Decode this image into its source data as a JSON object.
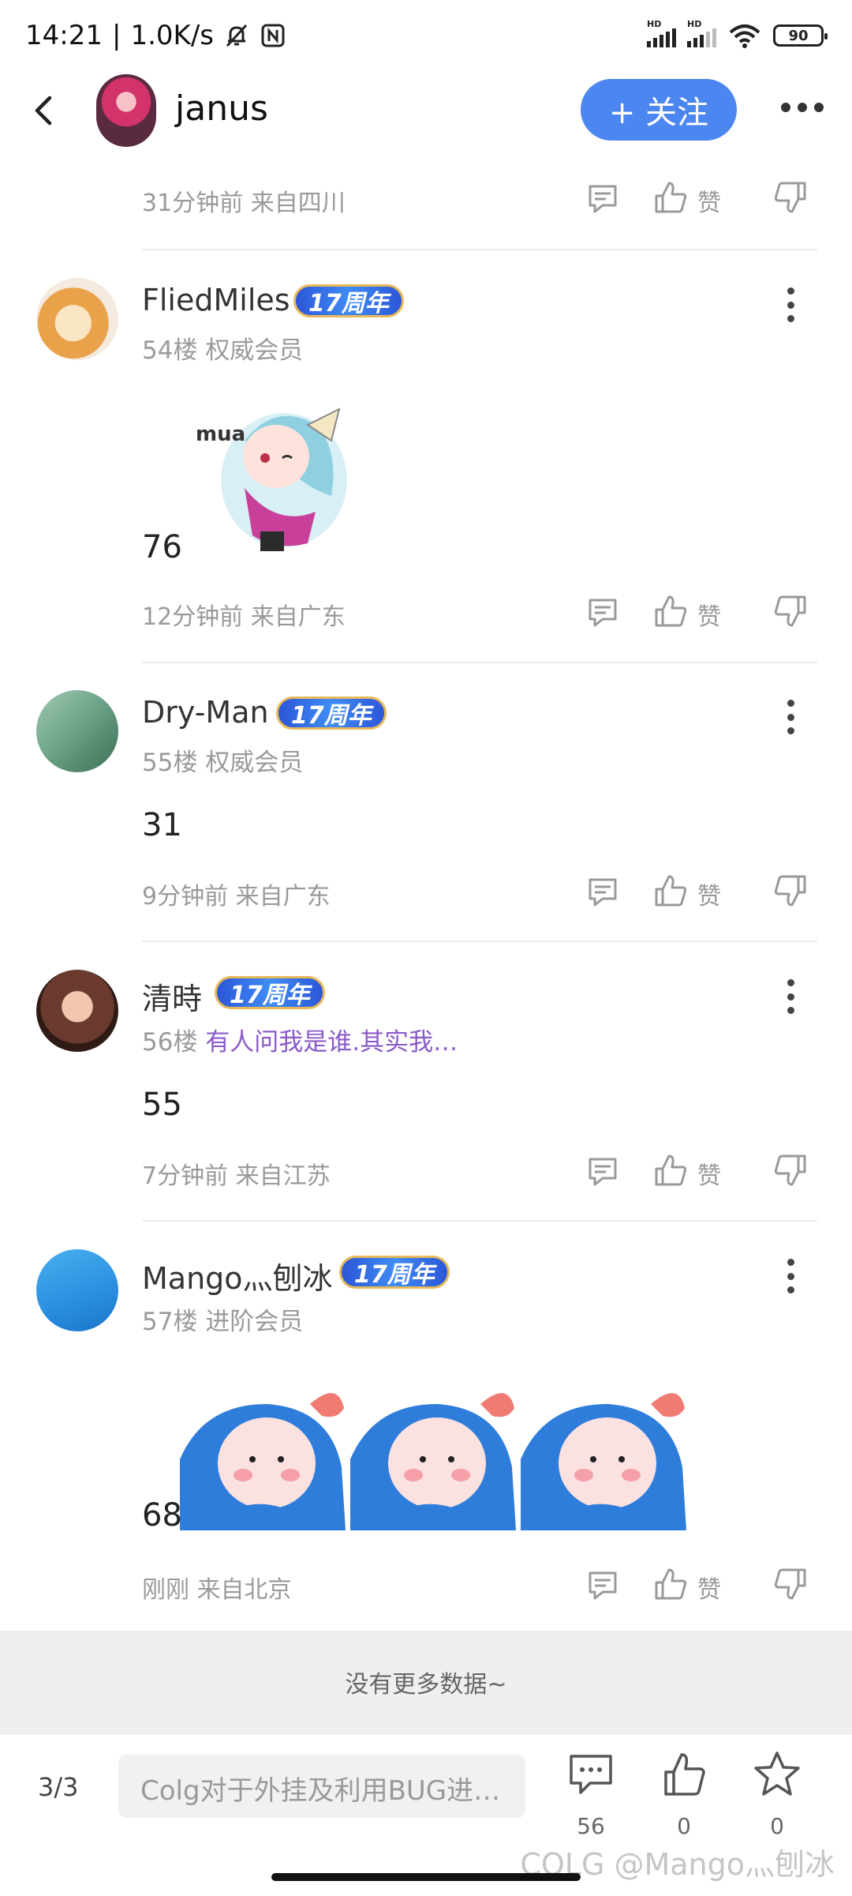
{
  "status_bar": {
    "time": "14:21",
    "net_speed": "1.0K/s",
    "hd1": "HD",
    "hd2": "HD",
    "battery": "90"
  },
  "header": {
    "username": "janus",
    "follow_label": "+ 关注"
  },
  "top_meta": "31分钟前 来自四川",
  "like_label": "赞",
  "posts": [
    {
      "username": "FliedMiles",
      "badge": "17周年",
      "floor": "54楼",
      "role": "权威会员",
      "content": "76",
      "meta": "12分钟前 来自广东",
      "sticker_text": "mua"
    },
    {
      "username": "Dry-Man",
      "badge": "17周年",
      "floor": "55楼",
      "role": "权威会员",
      "content": "31",
      "meta": "9分钟前 来自广东"
    },
    {
      "username": "清時",
      "badge": "17周年",
      "floor": "56楼",
      "role": "有人问我是谁.其实我…",
      "content": "55",
      "meta": "7分钟前 来自江苏"
    },
    {
      "username": "Mango灬刨冰",
      "badge": "17周年",
      "floor": "57楼",
      "role": "进阶会员",
      "content": "68",
      "meta": "刚刚 来自北京"
    }
  ],
  "no_more": "没有更多数据~",
  "bottom_bar": {
    "page_indicator": "3/3",
    "title": "Colg对于外挂及利用BUG进…",
    "comment_count": "56",
    "like_count": "0",
    "favorite_count": "0"
  },
  "watermark": "COLG @Mango灬刨冰",
  "colors": {
    "accent": "#4c86f0",
    "badge": "#3f8cf5",
    "signature": "#8a5ac8"
  },
  "icons": [
    "back-icon",
    "reply-icon",
    "like-icon",
    "dislike-icon",
    "more-icon",
    "comment-icon",
    "star-icon"
  ]
}
